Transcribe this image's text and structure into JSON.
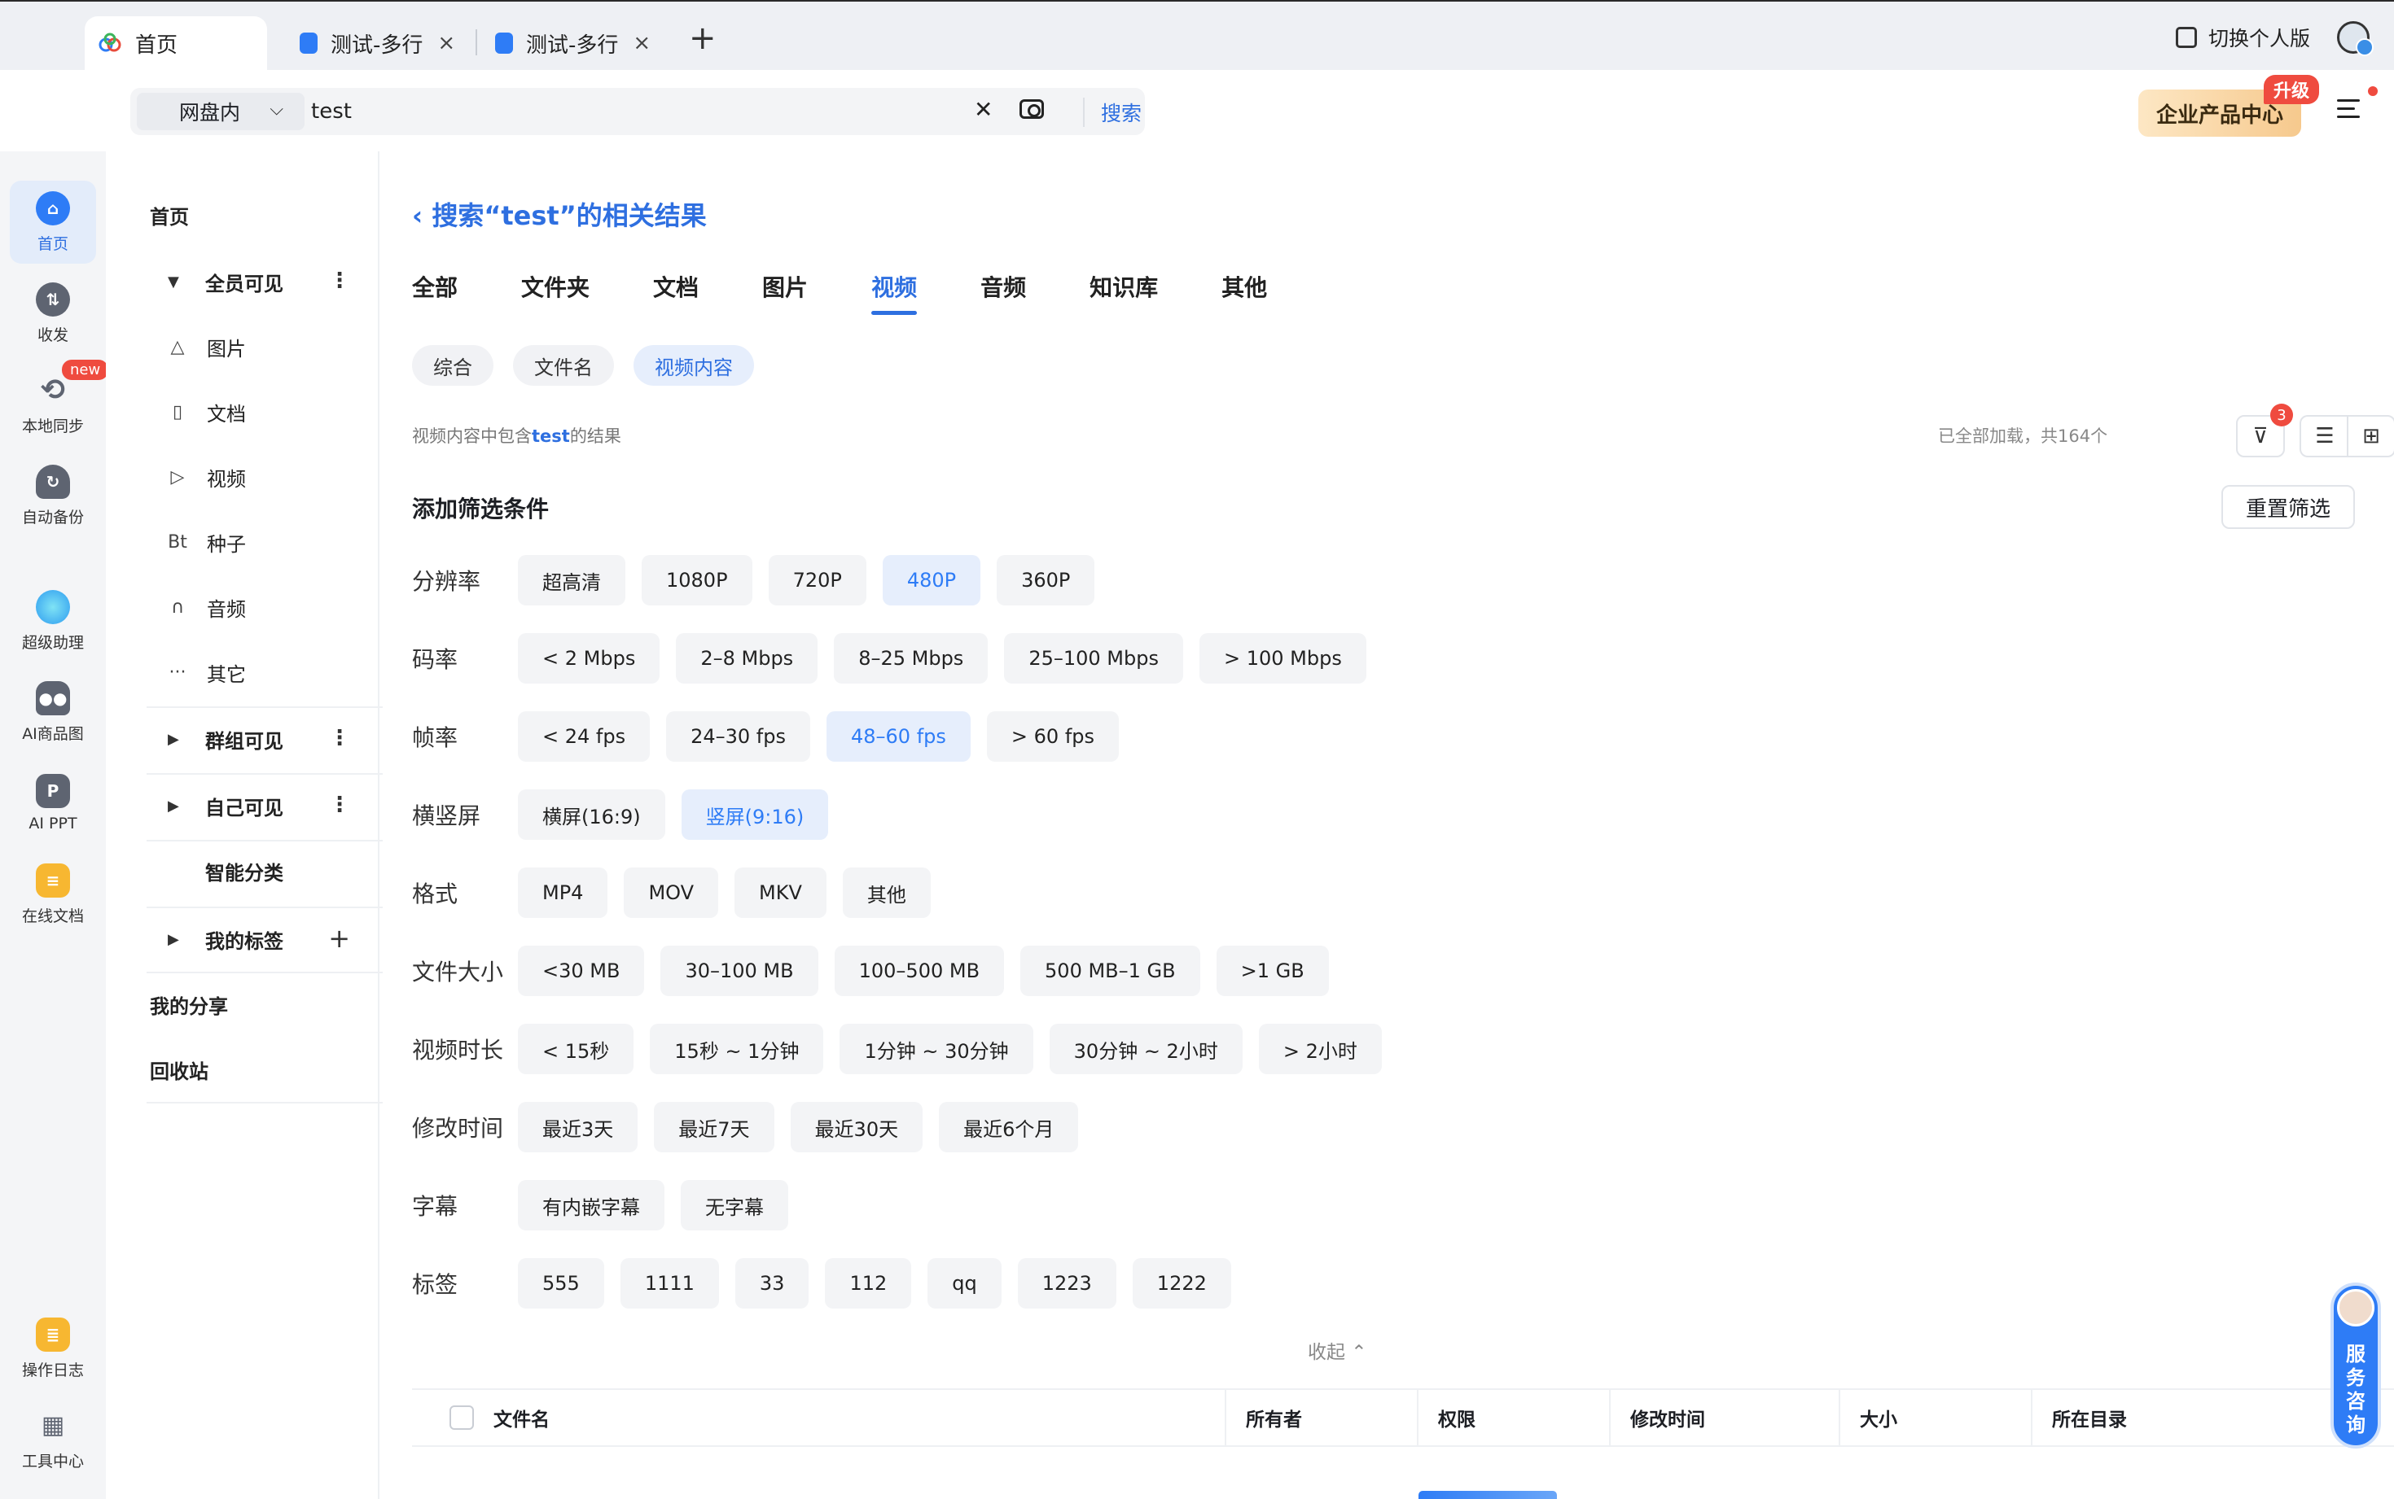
{
  "browser": {
    "tabs": [
      {
        "label": "首页",
        "active": true
      },
      {
        "label": "测试-多行",
        "active": false
      },
      {
        "label": "测试-多行",
        "active": false
      }
    ],
    "new_tab": "+",
    "close_glyph": "×",
    "switch_label": "切换个人版"
  },
  "header": {
    "scope": "网盘内",
    "query": "test",
    "search_button": "搜索",
    "enterprise_label": "企业产品中心",
    "upgrade_badge": "升级"
  },
  "rail": {
    "items": [
      {
        "label": "首页",
        "icon": "home-icon",
        "active": true
      },
      {
        "label": "收发",
        "icon": "transfer-icon"
      },
      {
        "label": "本地同步",
        "icon": "sync-icon"
      },
      {
        "label": "自动备份",
        "icon": "backup-icon"
      },
      {
        "label": "超级助理",
        "icon": "assistant-icon"
      },
      {
        "label": "AI商品图",
        "icon": "ai-product-icon"
      },
      {
        "label": "AI PPT",
        "icon": "ai-ppt-icon"
      },
      {
        "label": "在线文档",
        "icon": "online-doc-icon"
      },
      {
        "label": "操作日志",
        "icon": "log-icon"
      },
      {
        "label": "工具中心",
        "icon": "tools-icon"
      }
    ],
    "new_badge": "new"
  },
  "nav": {
    "home": "首页",
    "all_visible": "全员可见",
    "items": [
      {
        "label": "图片",
        "glyph": "△"
      },
      {
        "label": "文档",
        "glyph": "▯"
      },
      {
        "label": "视频",
        "glyph": "▷"
      },
      {
        "label": "种子",
        "glyph": "Bt"
      },
      {
        "label": "音频",
        "glyph": "∩"
      },
      {
        "label": "其它",
        "glyph": "···"
      }
    ],
    "group_visible": "群组可见",
    "self_visible": "自己可见",
    "smart_category": "智能分类",
    "my_tags": "我的标签",
    "my_share": "我的分享",
    "recycle": "回收站"
  },
  "main": {
    "back_title": "搜索“test”的相关结果",
    "tabs": [
      "全部",
      "文件夹",
      "文档",
      "图片",
      "视频",
      "音频",
      "知识库",
      "其他"
    ],
    "active_tab": "视频",
    "chips": [
      "综合",
      "文件名",
      "视频内容"
    ],
    "hint_prefix": "视频内容中包含",
    "hint_keyword": "test",
    "hint_suffix": "的结果",
    "loaded_text": "已全部加载，共164个",
    "filter_count": "3",
    "filter_title": "添加筛选条件",
    "reset_label": "重置筛选",
    "collapse_label": "收起 ⌃"
  },
  "filters": [
    {
      "label": "分辨率",
      "options": [
        "超高清",
        "1080P",
        "720P",
        "480P",
        "360P"
      ],
      "selected": [
        "480P"
      ]
    },
    {
      "label": "码率",
      "options": [
        "< 2 Mbps",
        "2–8 Mbps",
        "8–25 Mbps",
        "25–100 Mbps",
        "> 100 Mbps"
      ],
      "selected": []
    },
    {
      "label": "帧率",
      "options": [
        "< 24 fps",
        "24–30 fps",
        "48–60 fps",
        "> 60 fps"
      ],
      "selected": [
        "48–60 fps"
      ]
    },
    {
      "label": "横竖屏",
      "options": [
        "横屏(16:9)",
        "竖屏(9:16)"
      ],
      "selected": [
        "竖屏(9:16)"
      ]
    },
    {
      "label": "格式",
      "options": [
        "MP4",
        "MOV",
        "MKV",
        "其他"
      ],
      "selected": []
    },
    {
      "label": "文件大小",
      "options": [
        "<30 MB",
        "30–100 MB",
        "100–500 MB",
        "500 MB–1 GB",
        ">1 GB"
      ],
      "selected": []
    },
    {
      "label": "视频时长",
      "options": [
        "< 15秒",
        "15秒 ~ 1分钟",
        "1分钟 ~ 30分钟",
        "30分钟 ~ 2小时",
        "> 2小时"
      ],
      "selected": []
    },
    {
      "label": "修改时间",
      "options": [
        "最近3天",
        "最近7天",
        "最近30天",
        "最近6个月"
      ],
      "selected": []
    },
    {
      "label": "字幕",
      "options": [
        "有内嵌字幕",
        "无字幕"
      ],
      "selected": []
    },
    {
      "label": "标签",
      "options": [
        "555",
        "1111",
        "33",
        "112",
        "qq",
        "1223",
        "1222"
      ],
      "selected": []
    }
  ],
  "table": {
    "columns": [
      "文件名",
      "所有者",
      "权限",
      "修改时间",
      "大小",
      "所在目录"
    ]
  },
  "service": {
    "label": "服务咨询",
    "chars": [
      "服",
      "务",
      "咨",
      "询"
    ]
  },
  "colors": {
    "accent": "#2e6fe0",
    "selected_bg": "#e6eefc",
    "badge": "#ef4b3f"
  }
}
